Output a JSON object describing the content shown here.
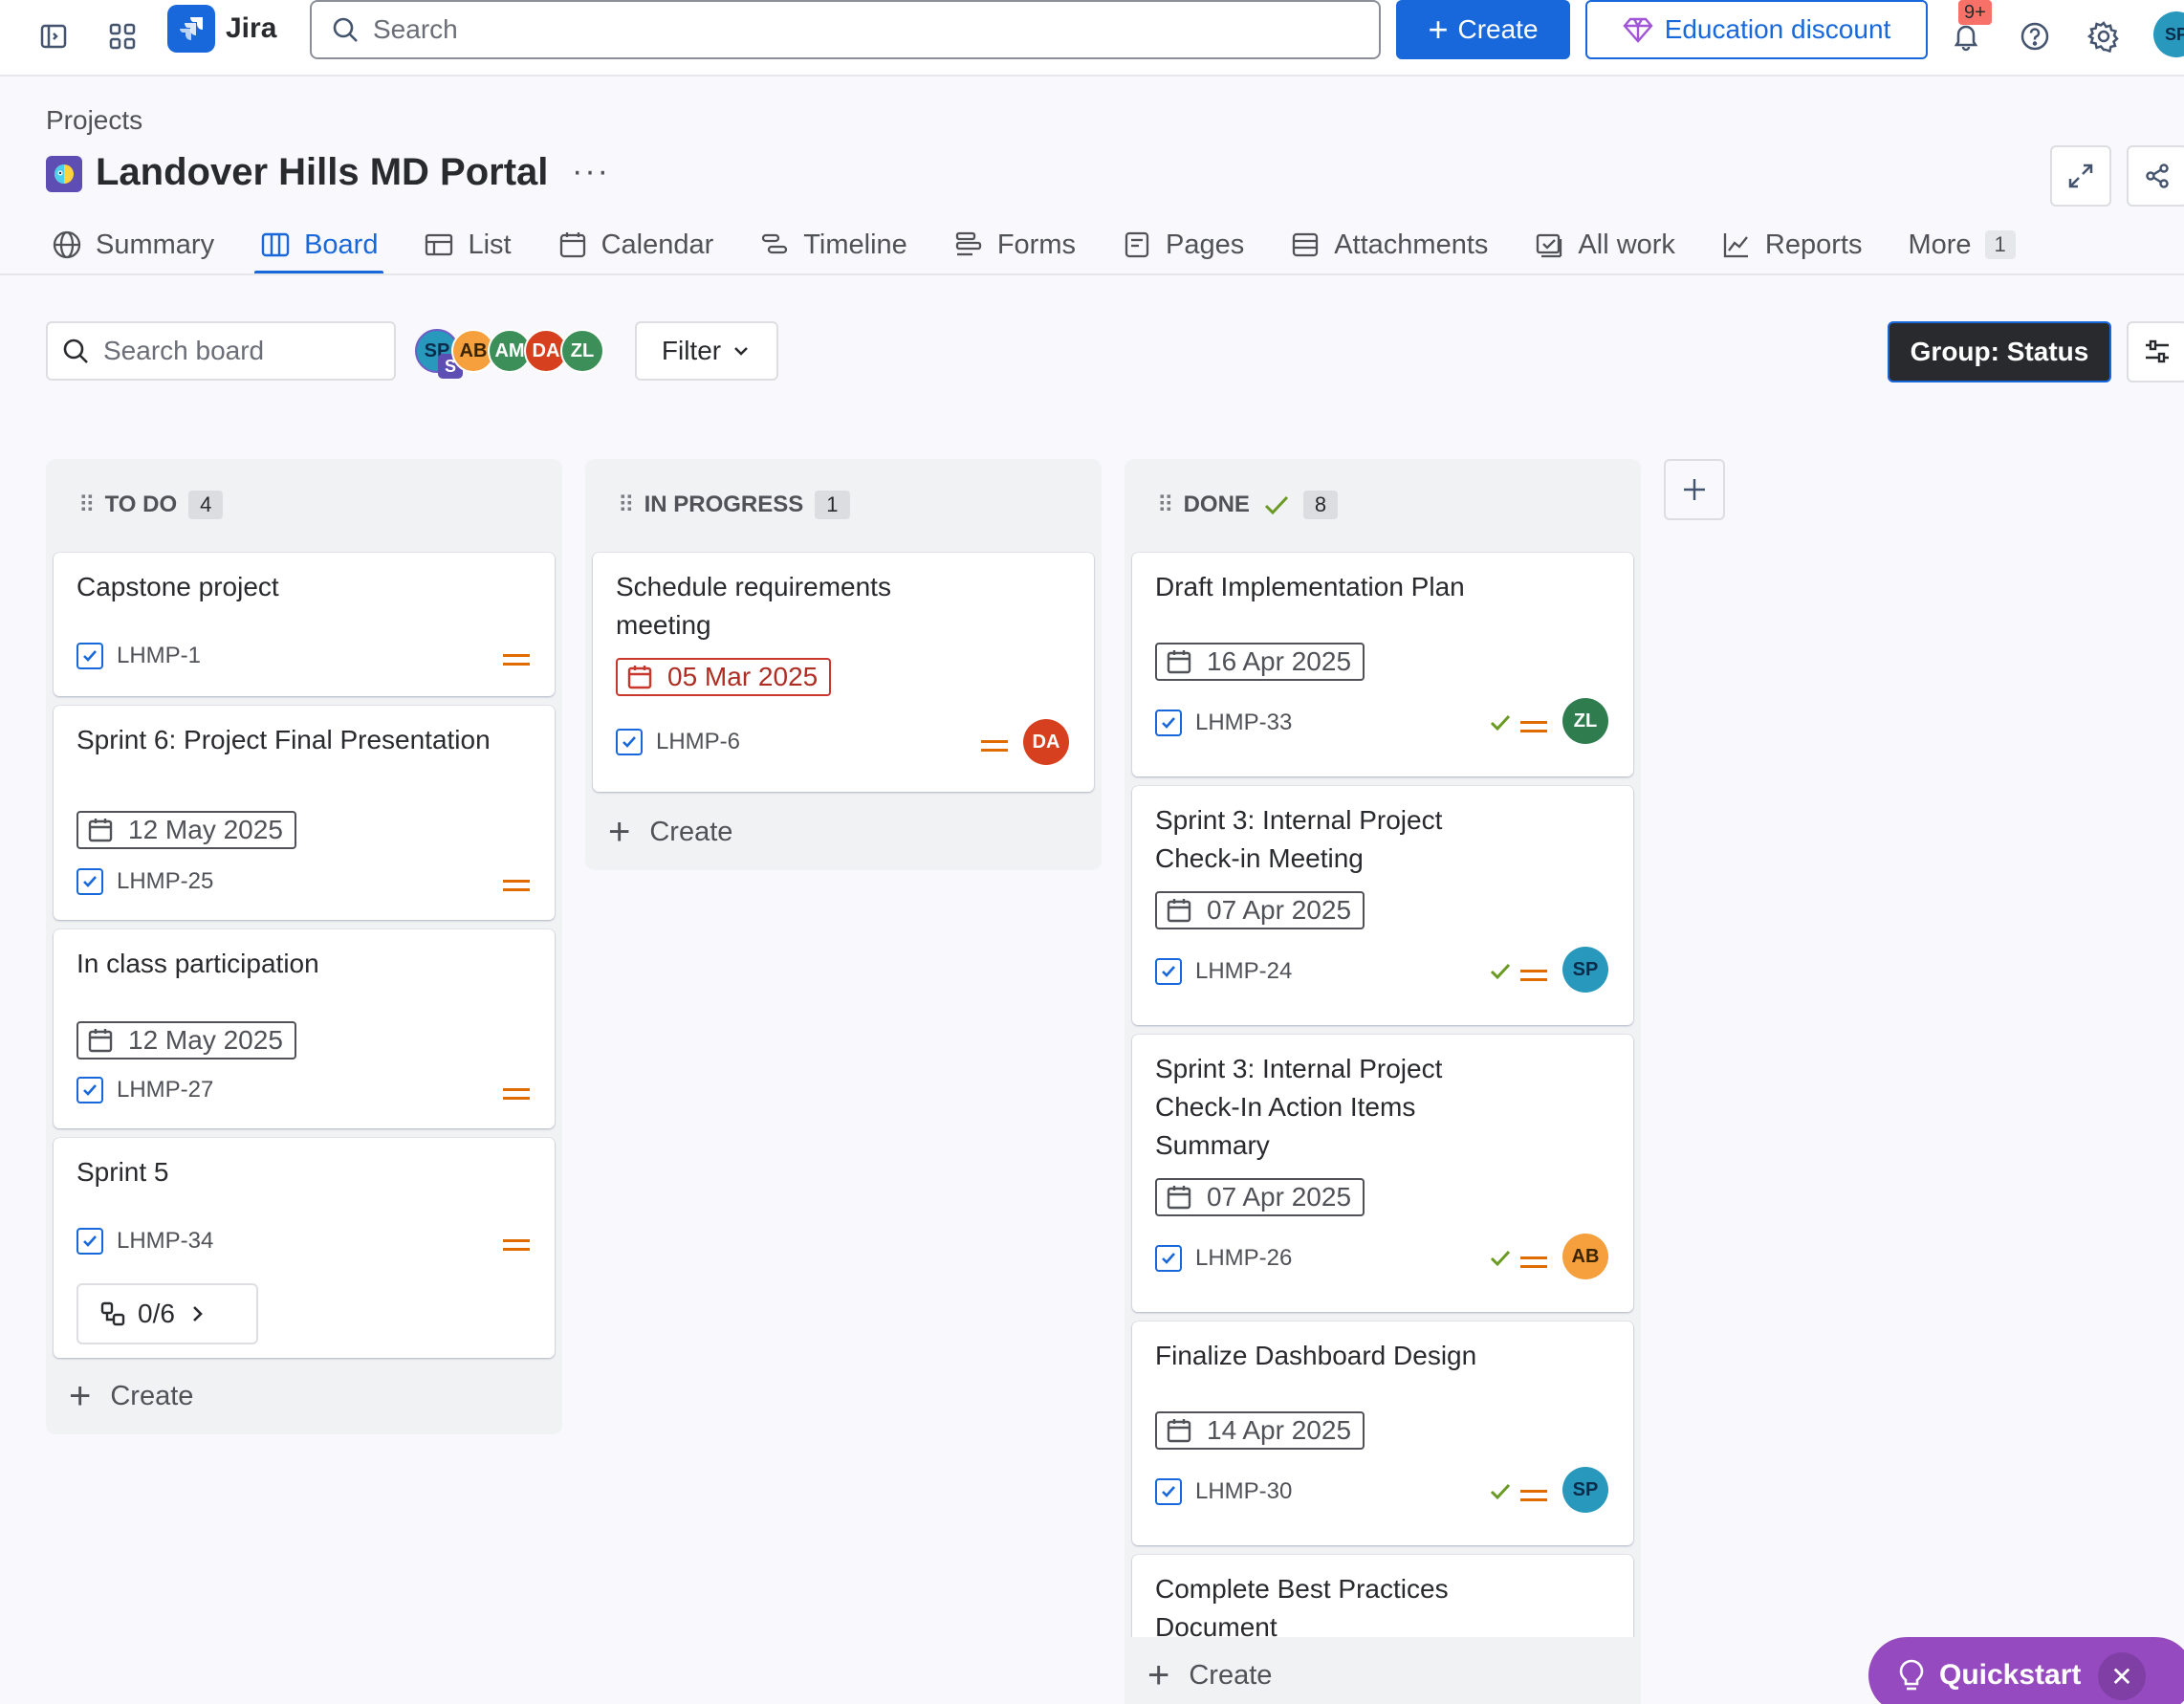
{
  "topbar": {
    "app_name": "Jira",
    "search_placeholder": "Search",
    "create_label": "Create",
    "education_label": "Education discount",
    "notifications_badge": "9+",
    "avatar_initials": "SP"
  },
  "project": {
    "breadcrumb": "Projects",
    "title": "Landover Hills MD Portal",
    "more": "···"
  },
  "tabs": [
    {
      "label": "Summary",
      "icon": "globe-icon"
    },
    {
      "label": "Board",
      "icon": "board-icon",
      "active": true
    },
    {
      "label": "List",
      "icon": "list-icon"
    },
    {
      "label": "Calendar",
      "icon": "calendar-icon"
    },
    {
      "label": "Timeline",
      "icon": "timeline-icon"
    },
    {
      "label": "Forms",
      "icon": "forms-icon"
    },
    {
      "label": "Pages",
      "icon": "pages-icon"
    },
    {
      "label": "Attachments",
      "icon": "attachments-icon"
    },
    {
      "label": "All work",
      "icon": "all-work-icon"
    },
    {
      "label": "Reports",
      "icon": "reports-icon"
    },
    {
      "label": "More",
      "count": "1"
    }
  ],
  "toolbar": {
    "search_placeholder": "Search board",
    "filter_label": "Filter",
    "group_label": "Group: Status",
    "avatars": [
      {
        "initials": "SP",
        "color": "#2898bd",
        "sub": "S"
      },
      {
        "initials": "AB",
        "color": "#f5a03d"
      },
      {
        "initials": "AM",
        "color": "#3d8f5a"
      },
      {
        "initials": "DA",
        "color": "#d7401f"
      },
      {
        "initials": "ZL",
        "color": "#3d8f5a"
      }
    ]
  },
  "columns": {
    "todo": {
      "title": "TO DO",
      "count": "4",
      "create": "Create"
    },
    "inprogress": {
      "title": "IN PROGRESS",
      "count": "1",
      "create": "Create"
    },
    "done": {
      "title": "DONE",
      "count": "8",
      "create": "Create"
    }
  },
  "cards": {
    "todo": [
      {
        "title": "Capstone project",
        "key": "LHMP-1"
      },
      {
        "title": "Sprint 6: Project Final Presentation",
        "due": "12 May 2025",
        "key": "LHMP-25"
      },
      {
        "title": "In class participation",
        "due": "12 May 2025",
        "key": "LHMP-27"
      },
      {
        "title": "Sprint 5",
        "key": "LHMP-34",
        "subtasks": "0/6"
      }
    ],
    "inprogress": [
      {
        "title": "Schedule requirements meeting",
        "due": "05 Mar 2025",
        "overdue": true,
        "key": "LHMP-6",
        "assignee": "DA"
      }
    ],
    "done": [
      {
        "title": "Draft Implementation Plan",
        "due": "16 Apr 2025",
        "key": "LHMP-33",
        "assignee": "ZL"
      },
      {
        "title": "Sprint 3: Internal Project Check-in Meeting",
        "due": "07 Apr 2025",
        "key": "LHMP-24",
        "assignee": "SP"
      },
      {
        "title": "Sprint 3: Internal Project Check-In Action Items Summary",
        "due": "07 Apr 2025",
        "key": "LHMP-26",
        "assignee": "AB"
      },
      {
        "title": "Finalize Dashboard Design",
        "due": "14 Apr 2025",
        "key": "LHMP-30",
        "assignee": "SP"
      },
      {
        "title": "Complete Best Practices Document"
      }
    ]
  },
  "quickstart": {
    "label": "Quickstart",
    "close": "✕"
  },
  "colors": {
    "primary": "#1868db",
    "priority_medium": "#e06c00",
    "done_green": "#6a9a23",
    "overdue_red": "#ae2e24"
  }
}
